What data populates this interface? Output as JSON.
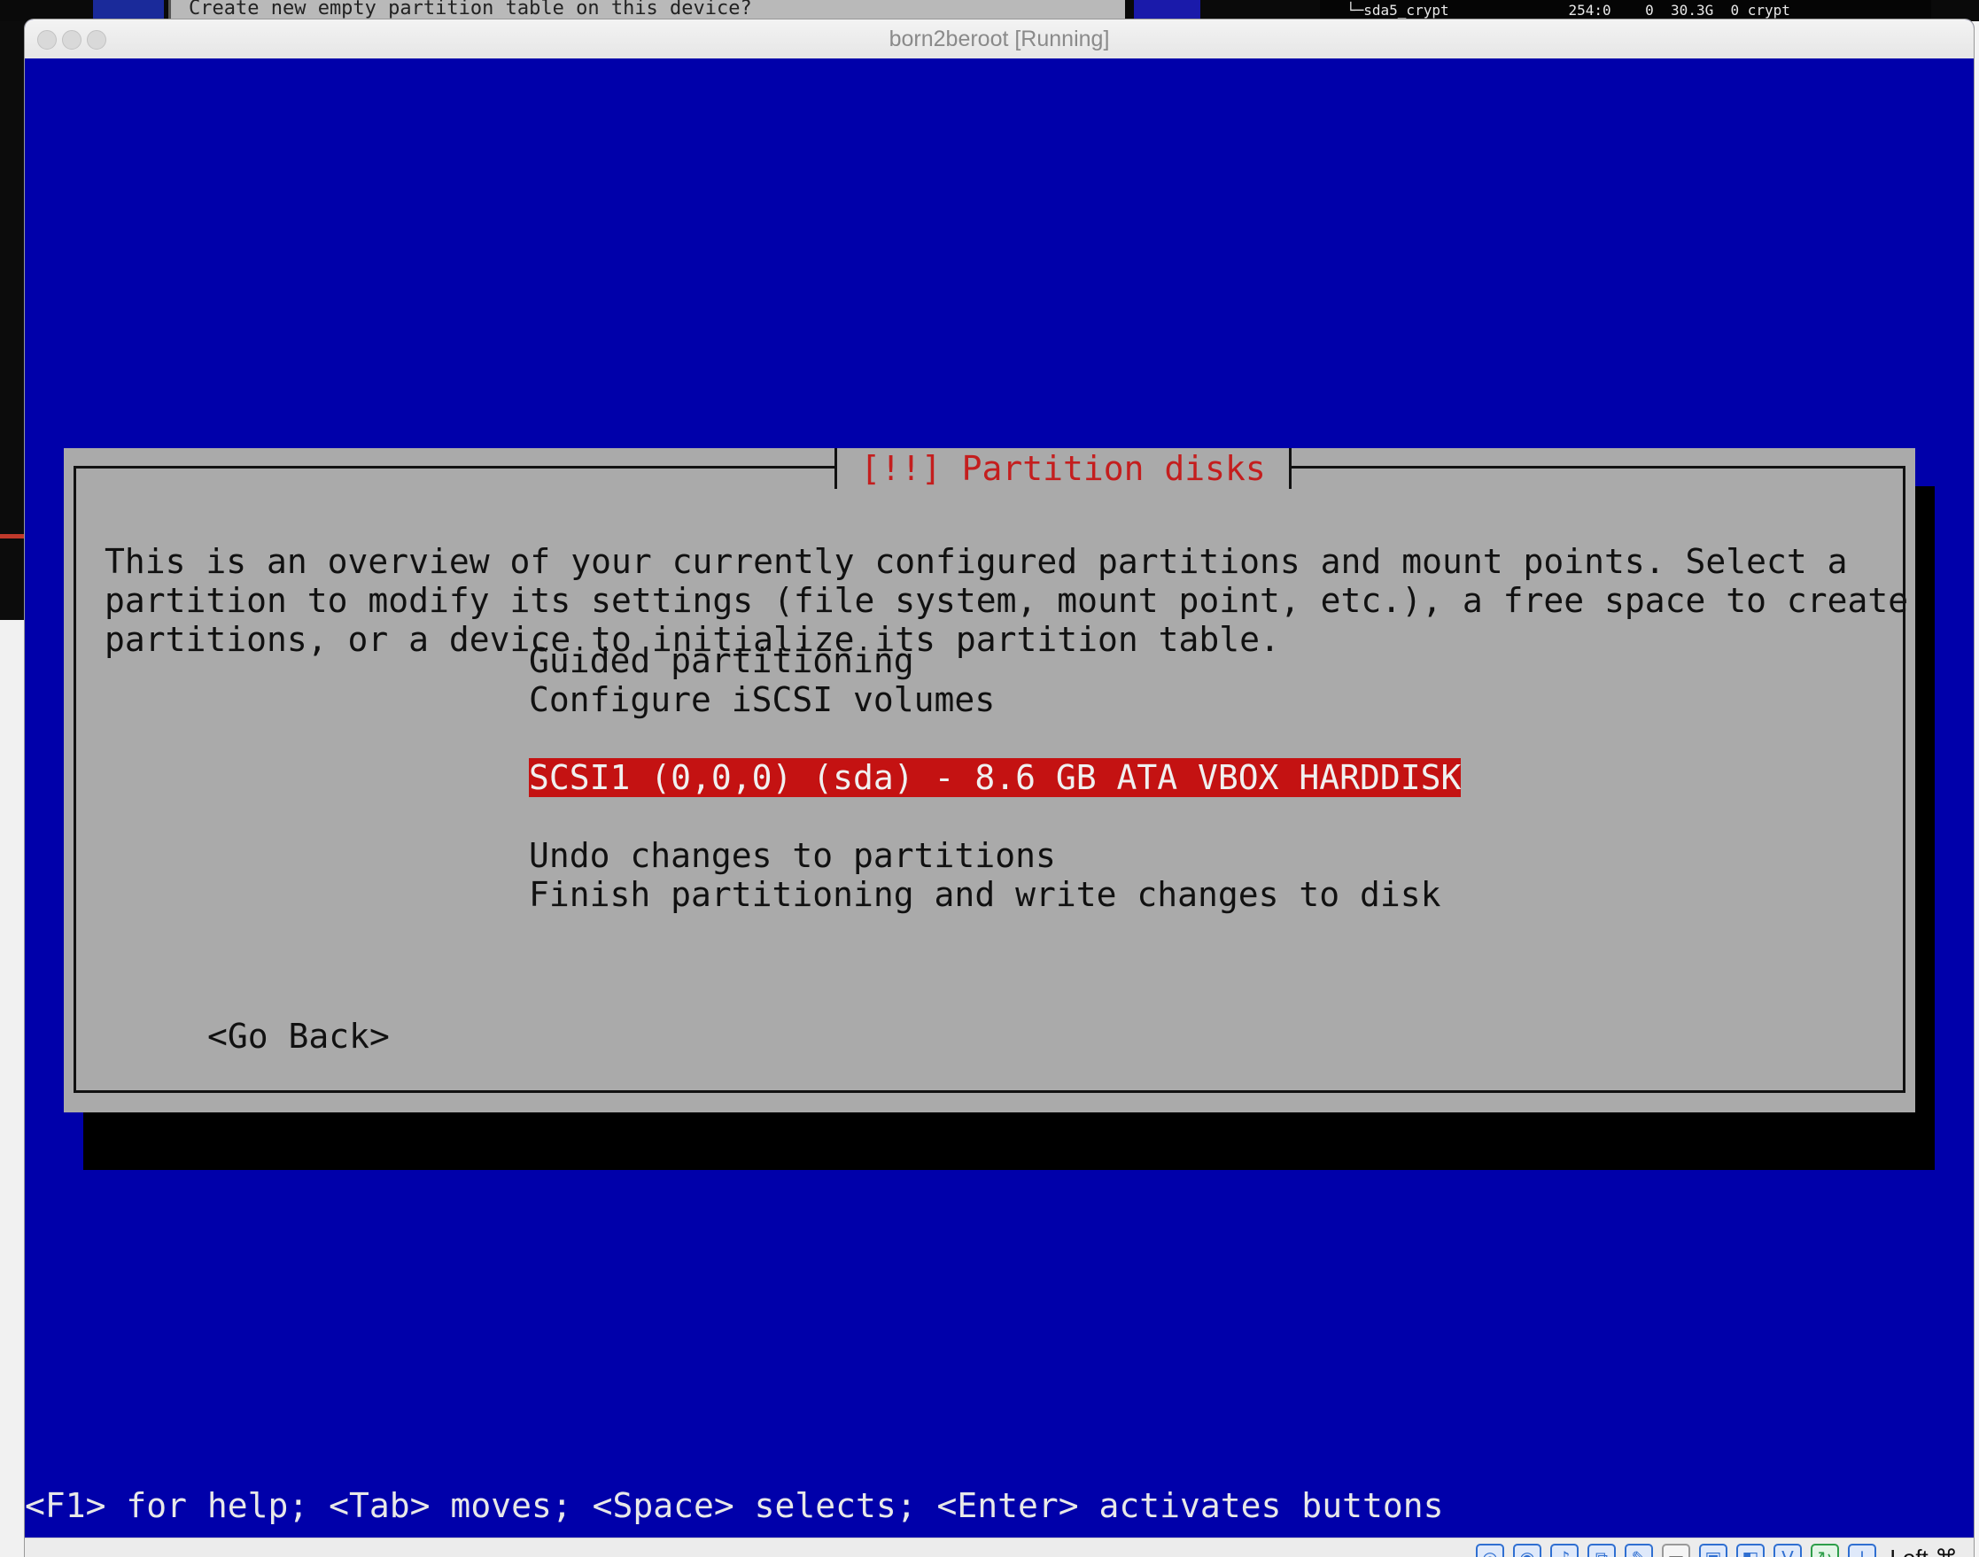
{
  "background": {
    "top_panel_text": "Create new empty partition table on this device?",
    "terminal_text": "└─sda5_crypt              254:0    0  30.3G  0 crypt"
  },
  "window": {
    "title": "born2beroot [Running]"
  },
  "dialog": {
    "title": "[!!] Partition disks",
    "description_lines": [
      "This is an overview of your currently configured partitions and mount points. Select a",
      "partition to modify its settings (file system, mount point, etc.), a free space to create",
      "partitions, or a device to initialize its partition table."
    ],
    "menu": {
      "guided": "Guided partitioning",
      "iscsi": "Configure iSCSI volumes",
      "disk": "SCSI1 (0,0,0) (sda) - 8.6 GB ATA VBOX HARDDISK",
      "undo": "Undo changes to partitions",
      "finish": "Finish partitioning and write changes to disk"
    },
    "go_back": "<Go Back>"
  },
  "help_line": "<F1> for help; <Tab> moves; <Space> selects; <Enter> activates buttons",
  "statusbar": {
    "icons": [
      "hard-disk-icon",
      "optical-drive-icon",
      "audio-icon",
      "network-icon",
      "usb-icon",
      "shared-folder-icon",
      "display-icon",
      "recording-icon",
      "cpu-icon",
      "mouse-integration-icon",
      "download-icon"
    ],
    "host_key": "Left ⌘"
  },
  "colors": {
    "screen_blue": "#0000aa",
    "dialog_gray": "#aaaaaa",
    "title_red": "#c41e1e",
    "selection_red": "#c41212"
  }
}
